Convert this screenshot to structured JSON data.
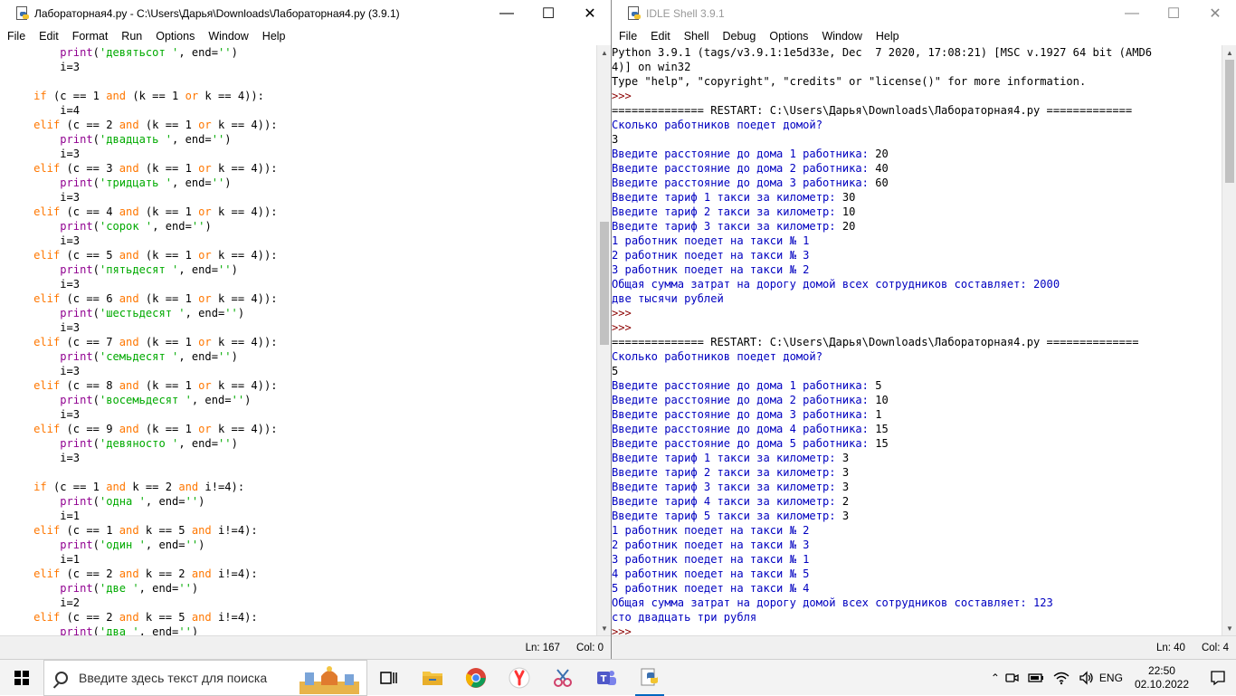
{
  "editor": {
    "title": "Лабораторная4.py - C:\\Users\\Дарья\\Downloads\\Лабораторная4.py (3.9.1)",
    "menu": [
      "File",
      "Edit",
      "Format",
      "Run",
      "Options",
      "Window",
      "Help"
    ],
    "status": {
      "line": "Ln: 167",
      "col": "Col: 0"
    },
    "scroll_fraction": 0.37,
    "lines": [
      [
        [
          "bi",
          "        print"
        ],
        [
          "",
          "("
        ],
        [
          "st",
          "'девятьсот '"
        ],
        [
          "",
          ", end="
        ],
        [
          "st",
          "''"
        ],
        [
          "",
          ")"
        ]
      ],
      [
        [
          "",
          "        i=3"
        ]
      ],
      [
        [
          "",
          ""
        ]
      ],
      [
        [
          "kw",
          "    if"
        ],
        [
          "",
          " (c == 1 "
        ],
        [
          "kw",
          "and"
        ],
        [
          "",
          " (k == 1 "
        ],
        [
          "kw",
          "or"
        ],
        [
          "",
          " k == 4)):"
        ]
      ],
      [
        [
          "",
          "        i=4"
        ]
      ],
      [
        [
          "kw",
          "    elif"
        ],
        [
          "",
          " (c == 2 "
        ],
        [
          "kw",
          "and"
        ],
        [
          "",
          " (k == 1 "
        ],
        [
          "kw",
          "or"
        ],
        [
          "",
          " k == 4)):"
        ]
      ],
      [
        [
          "bi",
          "        print"
        ],
        [
          "",
          "("
        ],
        [
          "st",
          "'двадцать '"
        ],
        [
          "",
          ", end="
        ],
        [
          "st",
          "''"
        ],
        [
          "",
          ")"
        ]
      ],
      [
        [
          "",
          "        i=3"
        ]
      ],
      [
        [
          "kw",
          "    elif"
        ],
        [
          "",
          " (c == 3 "
        ],
        [
          "kw",
          "and"
        ],
        [
          "",
          " (k == 1 "
        ],
        [
          "kw",
          "or"
        ],
        [
          "",
          " k == 4)):"
        ]
      ],
      [
        [
          "bi",
          "        print"
        ],
        [
          "",
          "("
        ],
        [
          "st",
          "'тридцать '"
        ],
        [
          "",
          ", end="
        ],
        [
          "st",
          "''"
        ],
        [
          "",
          ")"
        ]
      ],
      [
        [
          "",
          "        i=3"
        ]
      ],
      [
        [
          "kw",
          "    elif"
        ],
        [
          "",
          " (c == 4 "
        ],
        [
          "kw",
          "and"
        ],
        [
          "",
          " (k == 1 "
        ],
        [
          "kw",
          "or"
        ],
        [
          "",
          " k == 4)):"
        ]
      ],
      [
        [
          "bi",
          "        print"
        ],
        [
          "",
          "("
        ],
        [
          "st",
          "'сорок '"
        ],
        [
          "",
          ", end="
        ],
        [
          "st",
          "''"
        ],
        [
          "",
          ")"
        ]
      ],
      [
        [
          "",
          "        i=3"
        ]
      ],
      [
        [
          "kw",
          "    elif"
        ],
        [
          "",
          " (c == 5 "
        ],
        [
          "kw",
          "and"
        ],
        [
          "",
          " (k == 1 "
        ],
        [
          "kw",
          "or"
        ],
        [
          "",
          " k == 4)):"
        ]
      ],
      [
        [
          "bi",
          "        print"
        ],
        [
          "",
          "("
        ],
        [
          "st",
          "'пятьдесят '"
        ],
        [
          "",
          ", end="
        ],
        [
          "st",
          "''"
        ],
        [
          "",
          ")"
        ]
      ],
      [
        [
          "",
          "        i=3"
        ]
      ],
      [
        [
          "kw",
          "    elif"
        ],
        [
          "",
          " (c == 6 "
        ],
        [
          "kw",
          "and"
        ],
        [
          "",
          " (k == 1 "
        ],
        [
          "kw",
          "or"
        ],
        [
          "",
          " k == 4)):"
        ]
      ],
      [
        [
          "bi",
          "        print"
        ],
        [
          "",
          "("
        ],
        [
          "st",
          "'шестьдесят '"
        ],
        [
          "",
          ", end="
        ],
        [
          "st",
          "''"
        ],
        [
          "",
          ")"
        ]
      ],
      [
        [
          "",
          "        i=3"
        ]
      ],
      [
        [
          "kw",
          "    elif"
        ],
        [
          "",
          " (c == 7 "
        ],
        [
          "kw",
          "and"
        ],
        [
          "",
          " (k == 1 "
        ],
        [
          "kw",
          "or"
        ],
        [
          "",
          " k == 4)):"
        ]
      ],
      [
        [
          "bi",
          "        print"
        ],
        [
          "",
          "("
        ],
        [
          "st",
          "'семьдесят '"
        ],
        [
          "",
          ", end="
        ],
        [
          "st",
          "''"
        ],
        [
          "",
          ")"
        ]
      ],
      [
        [
          "",
          "        i=3"
        ]
      ],
      [
        [
          "kw",
          "    elif"
        ],
        [
          "",
          " (c == 8 "
        ],
        [
          "kw",
          "and"
        ],
        [
          "",
          " (k == 1 "
        ],
        [
          "kw",
          "or"
        ],
        [
          "",
          " k == 4)):"
        ]
      ],
      [
        [
          "bi",
          "        print"
        ],
        [
          "",
          "("
        ],
        [
          "st",
          "'восемьдесят '"
        ],
        [
          "",
          ", end="
        ],
        [
          "st",
          "''"
        ],
        [
          "",
          ")"
        ]
      ],
      [
        [
          "",
          "        i=3"
        ]
      ],
      [
        [
          "kw",
          "    elif"
        ],
        [
          "",
          " (c == 9 "
        ],
        [
          "kw",
          "and"
        ],
        [
          "",
          " (k == 1 "
        ],
        [
          "kw",
          "or"
        ],
        [
          "",
          " k == 4)):"
        ]
      ],
      [
        [
          "bi",
          "        print"
        ],
        [
          "",
          "("
        ],
        [
          "st",
          "'девяносто '"
        ],
        [
          "",
          ", end="
        ],
        [
          "st",
          "''"
        ],
        [
          "",
          ")"
        ]
      ],
      [
        [
          "",
          "        i=3"
        ]
      ],
      [
        [
          "",
          ""
        ]
      ],
      [
        [
          "kw",
          "    if"
        ],
        [
          "",
          " (c == 1 "
        ],
        [
          "kw",
          "and"
        ],
        [
          "",
          " k == 2 "
        ],
        [
          "kw",
          "and"
        ],
        [
          "",
          " i!=4):"
        ]
      ],
      [
        [
          "bi",
          "        print"
        ],
        [
          "",
          "("
        ],
        [
          "st",
          "'одна '"
        ],
        [
          "",
          ", end="
        ],
        [
          "st",
          "''"
        ],
        [
          "",
          ")"
        ]
      ],
      [
        [
          "",
          "        i=1"
        ]
      ],
      [
        [
          "kw",
          "    elif"
        ],
        [
          "",
          " (c == 1 "
        ],
        [
          "kw",
          "and"
        ],
        [
          "",
          " k == 5 "
        ],
        [
          "kw",
          "and"
        ],
        [
          "",
          " i!=4):"
        ]
      ],
      [
        [
          "bi",
          "        print"
        ],
        [
          "",
          "("
        ],
        [
          "st",
          "'один '"
        ],
        [
          "",
          ", end="
        ],
        [
          "st",
          "''"
        ],
        [
          "",
          ")"
        ]
      ],
      [
        [
          "",
          "        i=1"
        ]
      ],
      [
        [
          "kw",
          "    elif"
        ],
        [
          "",
          " (c == 2 "
        ],
        [
          "kw",
          "and"
        ],
        [
          "",
          " k == 2 "
        ],
        [
          "kw",
          "and"
        ],
        [
          "",
          " i!=4):"
        ]
      ],
      [
        [
          "bi",
          "        print"
        ],
        [
          "",
          "("
        ],
        [
          "st",
          "'две '"
        ],
        [
          "",
          ", end="
        ],
        [
          "st",
          "''"
        ],
        [
          "",
          ")"
        ]
      ],
      [
        [
          "",
          "        i=2"
        ]
      ],
      [
        [
          "kw",
          "    elif"
        ],
        [
          "",
          " (c == 2 "
        ],
        [
          "kw",
          "and"
        ],
        [
          "",
          " k == 5 "
        ],
        [
          "kw",
          "and"
        ],
        [
          "",
          " i!=4):"
        ]
      ],
      [
        [
          "bi",
          "        print"
        ],
        [
          "",
          "("
        ],
        [
          "st",
          "'два '"
        ],
        [
          "",
          ", end="
        ],
        [
          "st",
          "''"
        ],
        [
          "",
          ")"
        ]
      ]
    ]
  },
  "shell": {
    "title": "IDLE Shell 3.9.1",
    "menu": [
      "File",
      "Edit",
      "Shell",
      "Debug",
      "Options",
      "Window",
      "Help"
    ],
    "status": {
      "line": "Ln: 40",
      "col": "Col: 4"
    },
    "scroll_fraction": 0.0,
    "lines": [
      [
        [
          "inp",
          "Python 3.9.1 (tags/v3.9.1:1e5d33e, Dec  7 2020, 17:08:21) [MSC v.1927 64 bit (AMD6"
        ]
      ],
      [
        [
          "inp",
          "4)] on win32"
        ]
      ],
      [
        [
          "inp",
          "Type \"help\", \"copyright\", \"credits\" or \"license()\" for more information."
        ]
      ],
      [
        [
          "prompt",
          ">>> "
        ]
      ],
      [
        [
          "restart",
          "============== RESTART: C:\\Users\\Дарья\\Downloads\\Лабораторная4.py ============="
        ]
      ],
      [
        [
          "out",
          "Сколько работников поедет домой?"
        ]
      ],
      [
        [
          "inp",
          "3"
        ]
      ],
      [
        [
          "out",
          "Введите расстояние до дома 1 работника: "
        ],
        [
          "inp",
          "20"
        ]
      ],
      [
        [
          "out",
          "Введите расстояние до дома 2 работника: "
        ],
        [
          "inp",
          "40"
        ]
      ],
      [
        [
          "out",
          "Введите расстояние до дома 3 работника: "
        ],
        [
          "inp",
          "60"
        ]
      ],
      [
        [
          "out",
          "Введите тариф 1 такси за километр: "
        ],
        [
          "inp",
          "30"
        ]
      ],
      [
        [
          "out",
          "Введите тариф 2 такси за километр: "
        ],
        [
          "inp",
          "10"
        ]
      ],
      [
        [
          "out",
          "Введите тариф 3 такси за километр: "
        ],
        [
          "inp",
          "20"
        ]
      ],
      [
        [
          "out",
          "1 работник поедет на такси № 1"
        ]
      ],
      [
        [
          "out",
          "2 работник поедет на такси № 3"
        ]
      ],
      [
        [
          "out",
          "3 работник поедет на такси № 2"
        ]
      ],
      [
        [
          "out",
          "Общая сумма затрат на дорогу домой всех сотрудников составляет: 2000"
        ]
      ],
      [
        [
          "out",
          "две тысячи рублей"
        ]
      ],
      [
        [
          "prompt",
          ">>> "
        ]
      ],
      [
        [
          "prompt",
          ">>> "
        ]
      ],
      [
        [
          "restart",
          "============== RESTART: C:\\Users\\Дарья\\Downloads\\Лабораторная4.py =============="
        ]
      ],
      [
        [
          "out",
          "Сколько работников поедет домой?"
        ]
      ],
      [
        [
          "inp",
          "5"
        ]
      ],
      [
        [
          "out",
          "Введите расстояние до дома 1 работника: "
        ],
        [
          "inp",
          "5"
        ]
      ],
      [
        [
          "out",
          "Введите расстояние до дома 2 работника: "
        ],
        [
          "inp",
          "10"
        ]
      ],
      [
        [
          "out",
          "Введите расстояние до дома 3 работника: "
        ],
        [
          "inp",
          "1"
        ]
      ],
      [
        [
          "out",
          "Введите расстояние до дома 4 работника: "
        ],
        [
          "inp",
          "15"
        ]
      ],
      [
        [
          "out",
          "Введите расстояние до дома 5 работника: "
        ],
        [
          "inp",
          "15"
        ]
      ],
      [
        [
          "out",
          "Введите тариф 1 такси за километр: "
        ],
        [
          "inp",
          "3"
        ]
      ],
      [
        [
          "out",
          "Введите тариф 2 такси за километр: "
        ],
        [
          "inp",
          "3"
        ]
      ],
      [
        [
          "out",
          "Введите тариф 3 такси за километр: "
        ],
        [
          "inp",
          "3"
        ]
      ],
      [
        [
          "out",
          "Введите тариф 4 такси за километр: "
        ],
        [
          "inp",
          "2"
        ]
      ],
      [
        [
          "out",
          "Введите тариф 5 такси за километр: "
        ],
        [
          "inp",
          "3"
        ]
      ],
      [
        [
          "out",
          "1 работник поедет на такси № 2"
        ]
      ],
      [
        [
          "out",
          "2 работник поедет на такси № 3"
        ]
      ],
      [
        [
          "out",
          "3 работник поедет на такси № 1"
        ]
      ],
      [
        [
          "out",
          "4 работник поедет на такси № 5"
        ]
      ],
      [
        [
          "out",
          "5 работник поедет на такси № 4"
        ]
      ],
      [
        [
          "out",
          "Общая сумма затрат на дорогу домой всех сотрудников составляет: 123"
        ]
      ],
      [
        [
          "out",
          "сто двадцать три рубля"
        ]
      ],
      [
        [
          "prompt",
          ">>> "
        ]
      ]
    ]
  },
  "window_controls": {
    "minimize": "—",
    "maximize": "☐",
    "close": "✕"
  },
  "taskbar": {
    "search_placeholder": "Введите здесь текст для поиска",
    "language": "ENG",
    "time": "22:50",
    "date": "02.10.2022",
    "apps": [
      "task-view",
      "file-explorer",
      "chrome",
      "yandex-browser",
      "snipping-tool",
      "teams",
      "python-idle"
    ],
    "colors": {
      "accent": "#0067c0",
      "chrome_red": "#db4437",
      "yandex_red": "#f33",
      "teams_purple": "#5059c9",
      "python_blue": "#3a6fb0",
      "python_yellow": "#f2c430",
      "folder_yellow": "#f4c542"
    }
  }
}
